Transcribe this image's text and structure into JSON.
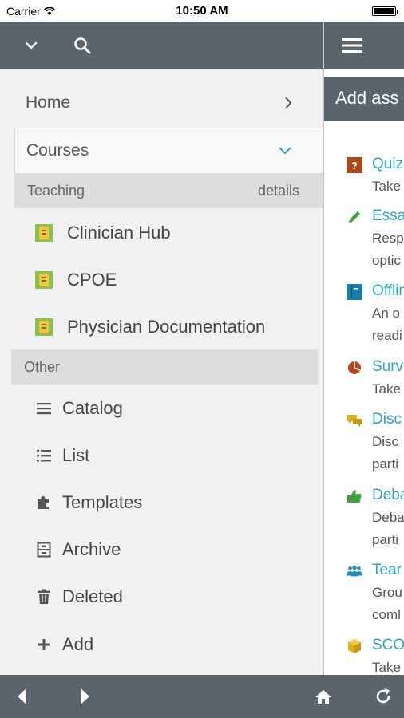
{
  "status_bar": {
    "carrier": "Carrier",
    "time": "10:50 AM"
  },
  "sidebar": {
    "home_label": "Home",
    "courses_label": "Courses",
    "teaching_header": "Teaching",
    "teaching_details": "details",
    "courses": [
      {
        "label": "Clinician Hub"
      },
      {
        "label": "CPOE"
      },
      {
        "label": "Physician Documentation"
      }
    ],
    "other_header": "Other",
    "other_items": [
      {
        "label": "Catalog",
        "icon": "list-icon"
      },
      {
        "label": "List",
        "icon": "bulleted-list-icon"
      },
      {
        "label": "Templates",
        "icon": "puzzle-icon"
      },
      {
        "label": "Archive",
        "icon": "archive-icon"
      },
      {
        "label": "Deleted",
        "icon": "trash-icon"
      },
      {
        "label": "Add",
        "icon": "plus-icon"
      }
    ]
  },
  "right_panel": {
    "add_title": "Add ass",
    "activities": [
      {
        "title": "Quiz",
        "desc": [
          "Take"
        ],
        "icon": "quiz-icon",
        "color": "#a84a1a"
      },
      {
        "title": "Essa",
        "desc": [
          "Resp",
          "optic"
        ],
        "icon": "pencil-icon",
        "color": "#3aa33a"
      },
      {
        "title": "Offlin",
        "desc": [
          "An o",
          "readi"
        ],
        "icon": "book-icon",
        "color": "#1a7fa8"
      },
      {
        "title": "Surv",
        "desc": [
          "Take"
        ],
        "icon": "pie-icon",
        "color": "#b8461e"
      },
      {
        "title": "Disc",
        "desc": [
          "Disc",
          "parti"
        ],
        "icon": "chat-icon",
        "color": "#e0b21a"
      },
      {
        "title": "Deba",
        "desc": [
          "Deba",
          "parti"
        ],
        "icon": "thumbs-up-icon",
        "color": "#3aa33a"
      },
      {
        "title": "Tear",
        "desc": [
          "Grou",
          "coml"
        ],
        "icon": "team-icon",
        "color": "#1a8fb8"
      },
      {
        "title": "SCO",
        "desc": [
          "Take"
        ],
        "icon": "cube-icon",
        "color": "#e0b21a"
      }
    ]
  }
}
